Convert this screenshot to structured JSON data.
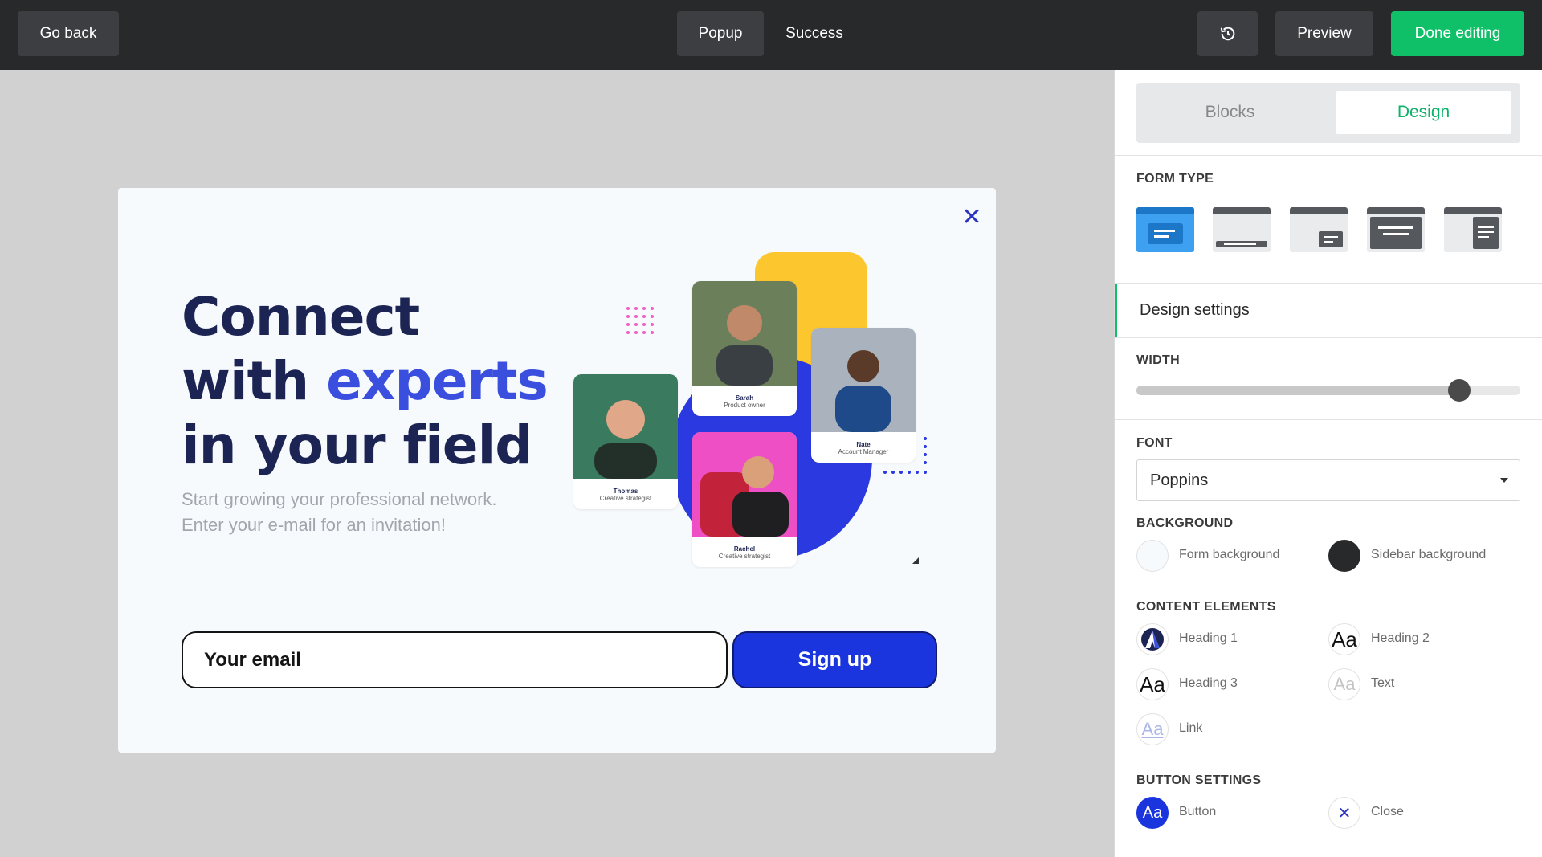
{
  "topbar": {
    "go_back": "Go back",
    "tabs": [
      "Popup",
      "Success"
    ],
    "history_icon": "history-icon",
    "preview": "Preview",
    "done": "Done editing"
  },
  "popup": {
    "heading_line1": "Connect",
    "heading_line2_a": "with ",
    "heading_line2_b": "experts",
    "heading_line3": "in your field",
    "subtext_line1": "Start growing your professional network.",
    "subtext_line2": "Enter your e-mail for an invitation!",
    "email_placeholder": "Your email",
    "signup": "Sign up",
    "people": [
      {
        "name": "Sarah",
        "role": "Product owner"
      },
      {
        "name": "Nate",
        "role": "Account Manager"
      },
      {
        "name": "Thomas",
        "role": "Creative strategist"
      },
      {
        "name": "Rachel",
        "role": "Creative strategist"
      }
    ]
  },
  "panel": {
    "tabs": {
      "blocks": "Blocks",
      "design": "Design"
    },
    "form_type_title": "FORM TYPE",
    "design_settings": "Design settings",
    "width_title": "WIDTH",
    "width_value": 0.84,
    "font_title": "FONT",
    "font_value": "Poppins",
    "background_title": "BACKGROUND",
    "background": {
      "form": "Form background",
      "sidebar": "Sidebar background"
    },
    "content_title": "CONTENT ELEMENTS",
    "content": {
      "h1": "Heading 1",
      "h2": "Heading 2",
      "h3": "Heading 3",
      "text": "Text",
      "link": "Link"
    },
    "icon_glyph": "Aa",
    "button_title": "BUTTON SETTINGS",
    "buttons": {
      "button": "Button",
      "close": "Close"
    }
  },
  "colors": {
    "accent": "#0fc069",
    "brand_blue": "#1a35dd",
    "heading": "#1c2454"
  }
}
